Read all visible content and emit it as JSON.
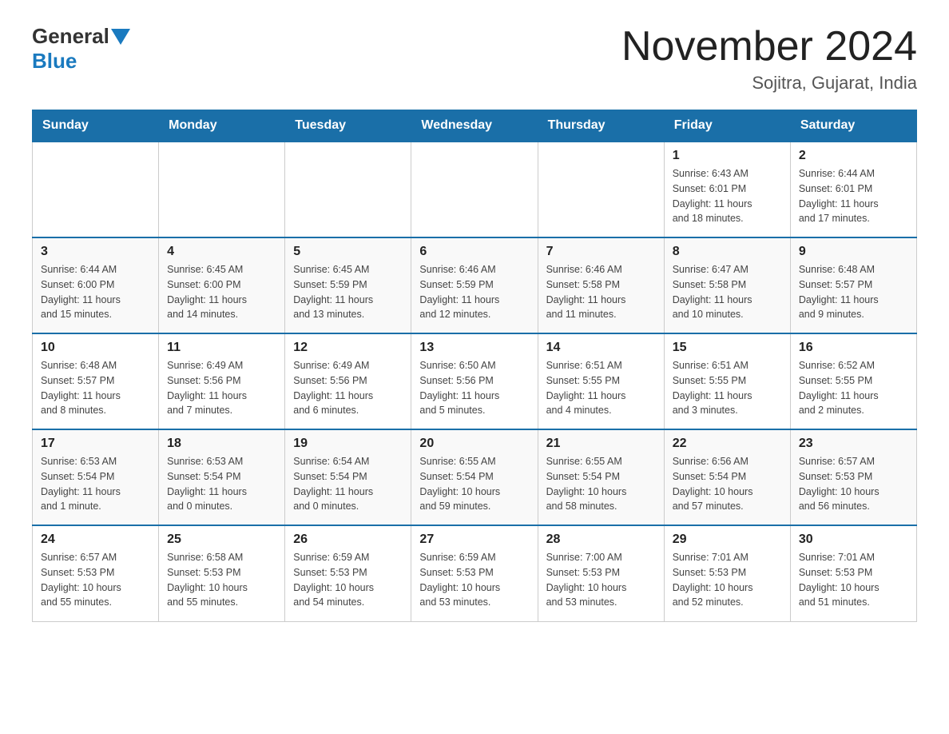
{
  "header": {
    "logo_general": "General",
    "logo_blue": "Blue",
    "month_title": "November 2024",
    "location": "Sojitra, Gujarat, India"
  },
  "weekdays": [
    "Sunday",
    "Monday",
    "Tuesday",
    "Wednesday",
    "Thursday",
    "Friday",
    "Saturday"
  ],
  "weeks": [
    [
      {
        "day": "",
        "info": ""
      },
      {
        "day": "",
        "info": ""
      },
      {
        "day": "",
        "info": ""
      },
      {
        "day": "",
        "info": ""
      },
      {
        "day": "",
        "info": ""
      },
      {
        "day": "1",
        "info": "Sunrise: 6:43 AM\nSunset: 6:01 PM\nDaylight: 11 hours\nand 18 minutes."
      },
      {
        "day": "2",
        "info": "Sunrise: 6:44 AM\nSunset: 6:01 PM\nDaylight: 11 hours\nand 17 minutes."
      }
    ],
    [
      {
        "day": "3",
        "info": "Sunrise: 6:44 AM\nSunset: 6:00 PM\nDaylight: 11 hours\nand 15 minutes."
      },
      {
        "day": "4",
        "info": "Sunrise: 6:45 AM\nSunset: 6:00 PM\nDaylight: 11 hours\nand 14 minutes."
      },
      {
        "day": "5",
        "info": "Sunrise: 6:45 AM\nSunset: 5:59 PM\nDaylight: 11 hours\nand 13 minutes."
      },
      {
        "day": "6",
        "info": "Sunrise: 6:46 AM\nSunset: 5:59 PM\nDaylight: 11 hours\nand 12 minutes."
      },
      {
        "day": "7",
        "info": "Sunrise: 6:46 AM\nSunset: 5:58 PM\nDaylight: 11 hours\nand 11 minutes."
      },
      {
        "day": "8",
        "info": "Sunrise: 6:47 AM\nSunset: 5:58 PM\nDaylight: 11 hours\nand 10 minutes."
      },
      {
        "day": "9",
        "info": "Sunrise: 6:48 AM\nSunset: 5:57 PM\nDaylight: 11 hours\nand 9 minutes."
      }
    ],
    [
      {
        "day": "10",
        "info": "Sunrise: 6:48 AM\nSunset: 5:57 PM\nDaylight: 11 hours\nand 8 minutes."
      },
      {
        "day": "11",
        "info": "Sunrise: 6:49 AM\nSunset: 5:56 PM\nDaylight: 11 hours\nand 7 minutes."
      },
      {
        "day": "12",
        "info": "Sunrise: 6:49 AM\nSunset: 5:56 PM\nDaylight: 11 hours\nand 6 minutes."
      },
      {
        "day": "13",
        "info": "Sunrise: 6:50 AM\nSunset: 5:56 PM\nDaylight: 11 hours\nand 5 minutes."
      },
      {
        "day": "14",
        "info": "Sunrise: 6:51 AM\nSunset: 5:55 PM\nDaylight: 11 hours\nand 4 minutes."
      },
      {
        "day": "15",
        "info": "Sunrise: 6:51 AM\nSunset: 5:55 PM\nDaylight: 11 hours\nand 3 minutes."
      },
      {
        "day": "16",
        "info": "Sunrise: 6:52 AM\nSunset: 5:55 PM\nDaylight: 11 hours\nand 2 minutes."
      }
    ],
    [
      {
        "day": "17",
        "info": "Sunrise: 6:53 AM\nSunset: 5:54 PM\nDaylight: 11 hours\nand 1 minute."
      },
      {
        "day": "18",
        "info": "Sunrise: 6:53 AM\nSunset: 5:54 PM\nDaylight: 11 hours\nand 0 minutes."
      },
      {
        "day": "19",
        "info": "Sunrise: 6:54 AM\nSunset: 5:54 PM\nDaylight: 11 hours\nand 0 minutes."
      },
      {
        "day": "20",
        "info": "Sunrise: 6:55 AM\nSunset: 5:54 PM\nDaylight: 10 hours\nand 59 minutes."
      },
      {
        "day": "21",
        "info": "Sunrise: 6:55 AM\nSunset: 5:54 PM\nDaylight: 10 hours\nand 58 minutes."
      },
      {
        "day": "22",
        "info": "Sunrise: 6:56 AM\nSunset: 5:54 PM\nDaylight: 10 hours\nand 57 minutes."
      },
      {
        "day": "23",
        "info": "Sunrise: 6:57 AM\nSunset: 5:53 PM\nDaylight: 10 hours\nand 56 minutes."
      }
    ],
    [
      {
        "day": "24",
        "info": "Sunrise: 6:57 AM\nSunset: 5:53 PM\nDaylight: 10 hours\nand 55 minutes."
      },
      {
        "day": "25",
        "info": "Sunrise: 6:58 AM\nSunset: 5:53 PM\nDaylight: 10 hours\nand 55 minutes."
      },
      {
        "day": "26",
        "info": "Sunrise: 6:59 AM\nSunset: 5:53 PM\nDaylight: 10 hours\nand 54 minutes."
      },
      {
        "day": "27",
        "info": "Sunrise: 6:59 AM\nSunset: 5:53 PM\nDaylight: 10 hours\nand 53 minutes."
      },
      {
        "day": "28",
        "info": "Sunrise: 7:00 AM\nSunset: 5:53 PM\nDaylight: 10 hours\nand 53 minutes."
      },
      {
        "day": "29",
        "info": "Sunrise: 7:01 AM\nSunset: 5:53 PM\nDaylight: 10 hours\nand 52 minutes."
      },
      {
        "day": "30",
        "info": "Sunrise: 7:01 AM\nSunset: 5:53 PM\nDaylight: 10 hours\nand 51 minutes."
      }
    ]
  ]
}
